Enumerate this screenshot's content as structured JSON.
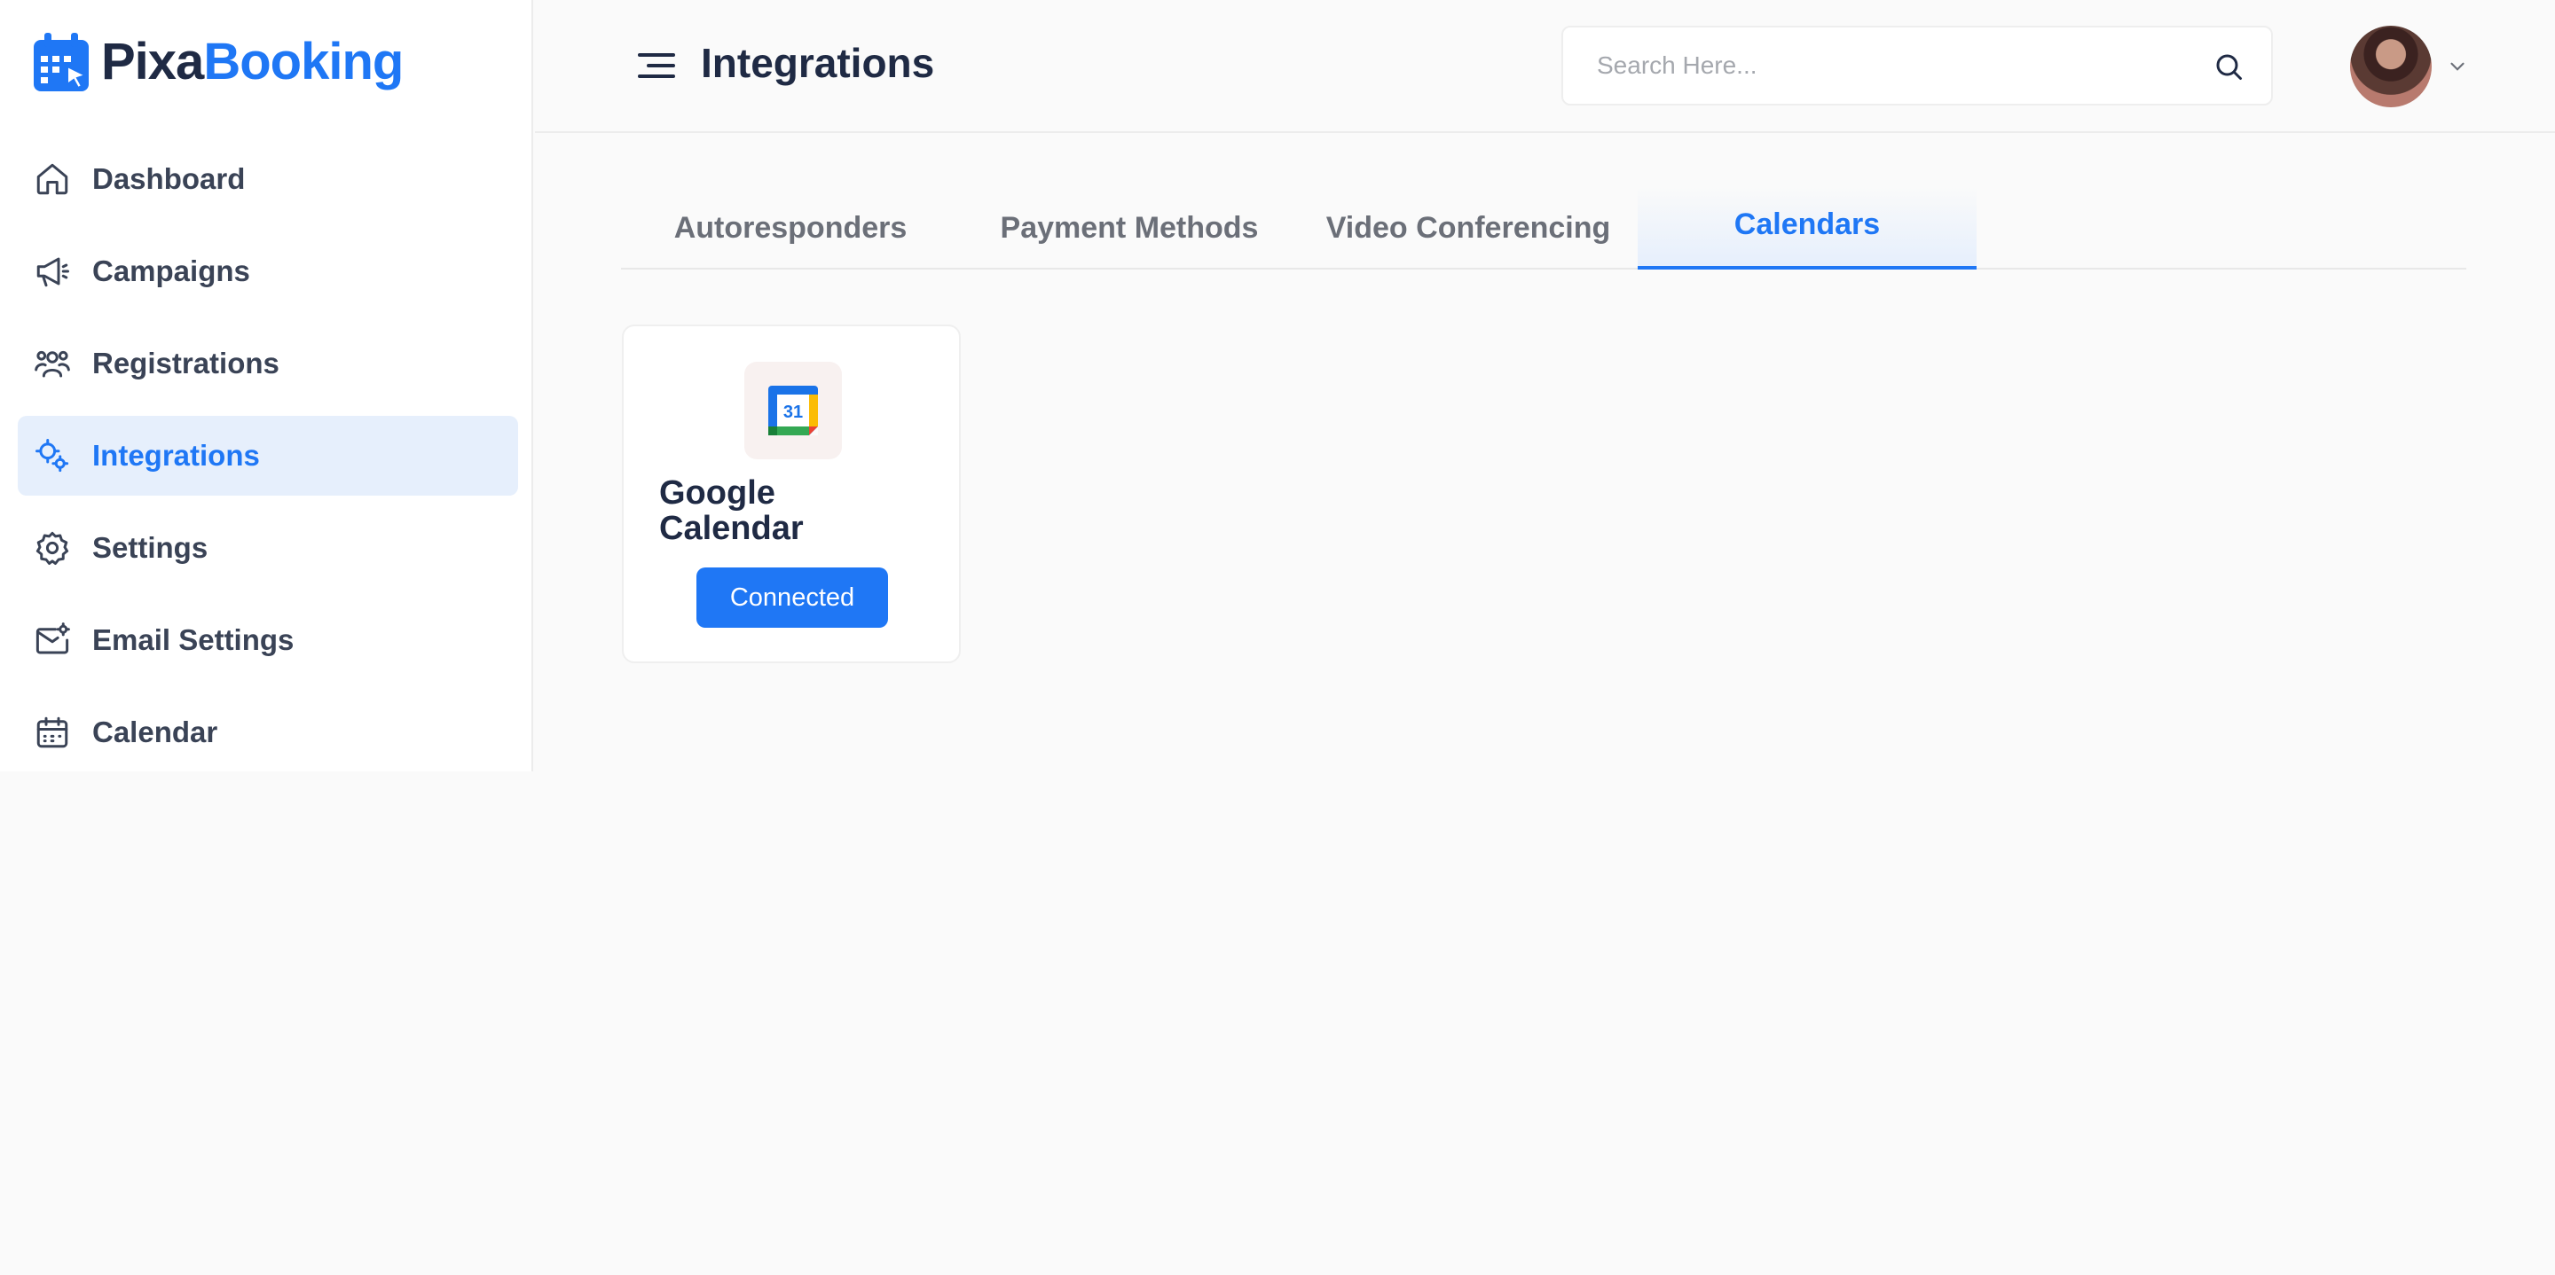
{
  "brand": {
    "name_part1": "Pixa",
    "name_part2": "Booking"
  },
  "sidebar": {
    "items": [
      {
        "label": "Dashboard",
        "icon": "home-icon"
      },
      {
        "label": "Campaigns",
        "icon": "megaphone-icon"
      },
      {
        "label": "Registrations",
        "icon": "users-icon"
      },
      {
        "label": "Integrations",
        "icon": "integrations-icon",
        "active": true
      },
      {
        "label": "Settings",
        "icon": "gear-icon"
      },
      {
        "label": "Email Settings",
        "icon": "email-settings-icon"
      },
      {
        "label": "Calendar",
        "icon": "calendar-icon"
      }
    ]
  },
  "header": {
    "title": "Integrations",
    "search_placeholder": "Search Here..."
  },
  "tabs": [
    {
      "label": "Autoresponders"
    },
    {
      "label": "Payment Methods"
    },
    {
      "label": "Video Conferencing"
    },
    {
      "label": "Calendars",
      "active": true
    }
  ],
  "integrations": [
    {
      "name": "Google Calendar",
      "icon": "google-calendar-icon",
      "icon_text": "31",
      "status_label": "Connected"
    }
  ],
  "colors": {
    "accent": "#1f77f5",
    "text_dark": "#1f2a44",
    "active_bg": "#e6effc"
  }
}
